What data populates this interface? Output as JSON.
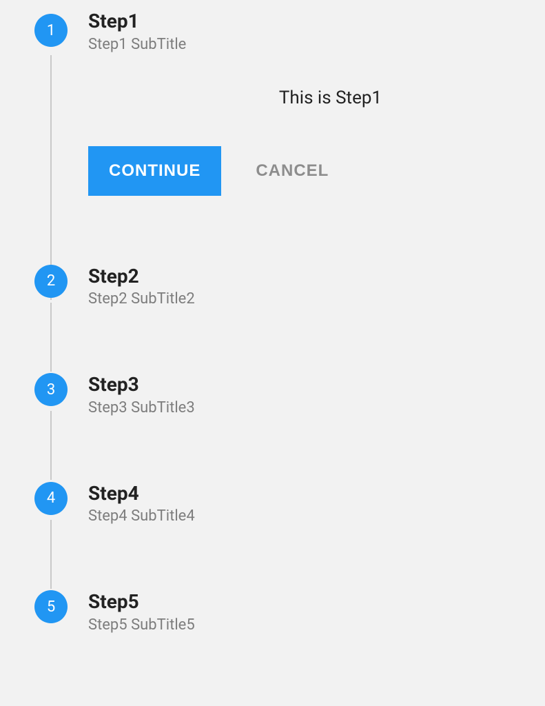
{
  "colors": {
    "accent": "#2196f3"
  },
  "stepper": {
    "active": 0,
    "steps": [
      {
        "number": "1",
        "title": "Step1",
        "subtitle": "Step1 SubTitle",
        "content": "This is Step1"
      },
      {
        "number": "2",
        "title": "Step2",
        "subtitle": "Step2 SubTitle2"
      },
      {
        "number": "3",
        "title": "Step3",
        "subtitle": "Step3 SubTitle3"
      },
      {
        "number": "4",
        "title": "Step4",
        "subtitle": "Step4 SubTitle4"
      },
      {
        "number": "5",
        "title": "Step5",
        "subtitle": "Step5 SubTitle5"
      }
    ],
    "buttons": {
      "continue": "CONTINUE",
      "cancel": "CANCEL"
    }
  }
}
